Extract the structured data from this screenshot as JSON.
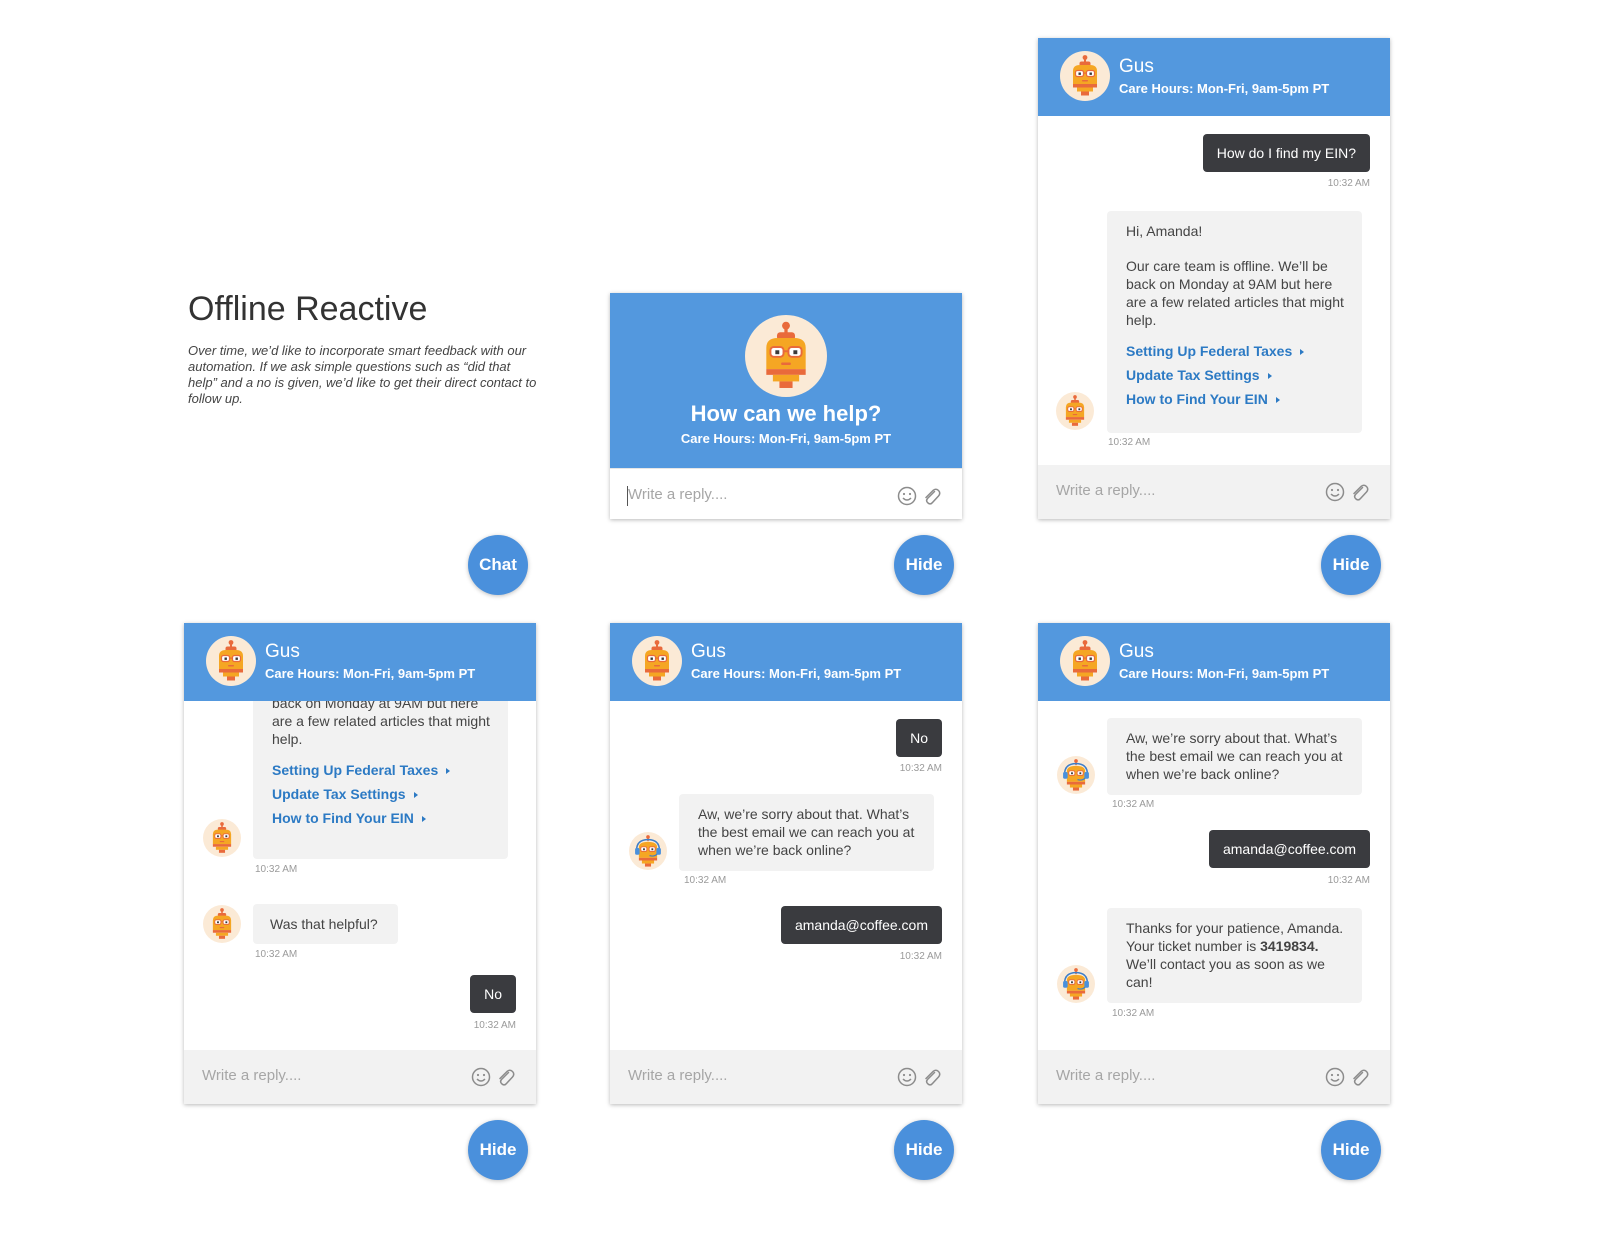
{
  "page": {
    "title": "Offline Reactive",
    "description": "Over time, we’d like to incorporate smart feedback with our automation. If we ask simple questions such as “did that help” and a no is given, we’d like to get their direct contact to follow up."
  },
  "bot": {
    "name": "Gus",
    "hours": "Care Hours: Mon-Fri, 9am-5pm PT"
  },
  "composer": {
    "placeholder": "Write a reply....",
    "emoji_icon": "smile-icon",
    "attach_icon": "paperclip-icon"
  },
  "buttons": {
    "chat": "Chat",
    "hide": "Hide"
  },
  "welcome": {
    "headline": "How can we help?"
  },
  "messages": {
    "time": "10:32 AM",
    "question": "How do I find my EIN?",
    "greeting": "Hi, Amanda!",
    "offline": "Our care team is offline. We’ll be back on Monday at 9AM but here are a few related articles that might help.",
    "offline_partial": "back on Monday at 9AM but here are a few related articles that might help.",
    "articles": [
      "Setting Up Federal Taxes",
      "Update Tax Settings",
      "How to Find Your EIN"
    ],
    "helpful": "Was that helpful?",
    "no": "No",
    "sorry": "Aw, we’re sorry about that. What’s the best email we can reach you at when we’re back online?",
    "email": "amanda@coffee.com",
    "thanks_pre": "Thanks for your patience, Amanda. Your ticket number is",
    "ticket": "3419834.",
    "thanks_post": "We’ll contact you as soon as we can!"
  },
  "colors": {
    "brand_blue": "#5398de",
    "button_blue": "#4a90dc",
    "link_blue": "#2c7ac4",
    "user_bubble": "#3a3b3f",
    "bot_bubble": "#f2f2f2"
  }
}
